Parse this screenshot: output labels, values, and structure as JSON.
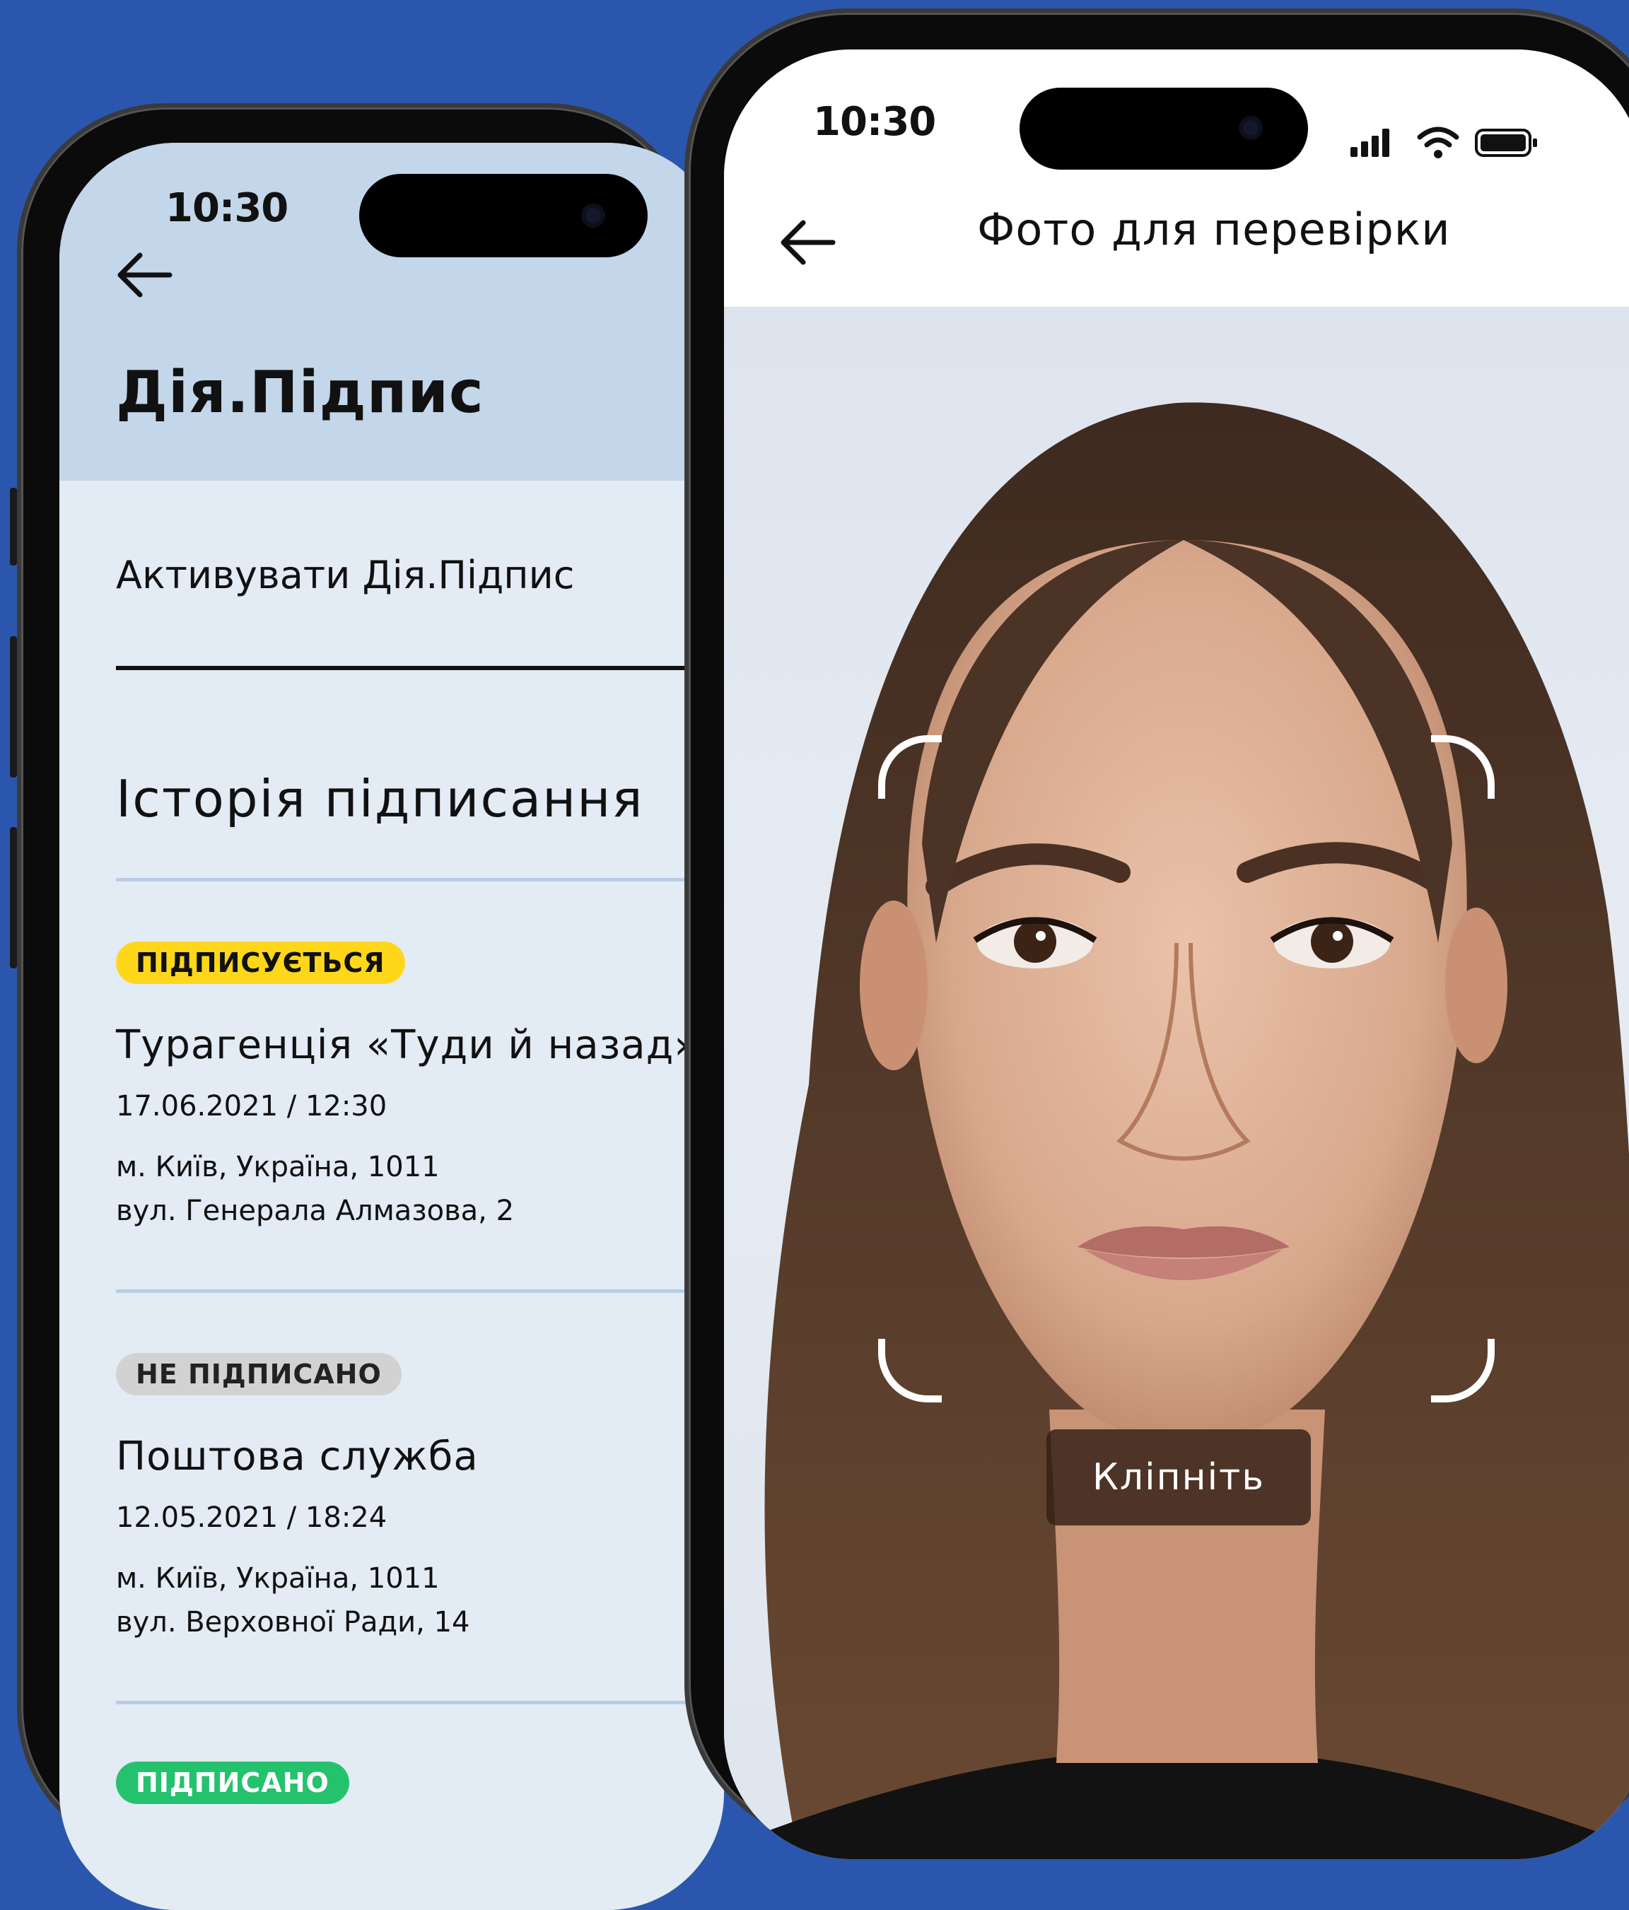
{
  "colors": {
    "background": "#2a57ad",
    "left_header": "#c3d6ea",
    "left_body": "#e3ebf5",
    "badge_signing": "#ffd71a",
    "badge_not_signed": "#d2d2d2",
    "badge_signed": "#25c26e"
  },
  "left_screen": {
    "status_time": "10:30",
    "title": "Дія.Підпис",
    "activate_label": "Активувати Дія.Підпис",
    "history_title": "Історія підписання",
    "entries": [
      {
        "badge": "ПІДПИСУЄТЬСЯ",
        "name": "Турагенція «Туди й назад»",
        "datetime": "17.06.2021 / 12:30",
        "address_line1": "м. Київ, Україна, 1011",
        "address_line2": "вул. Генерала Алмазова, 2"
      },
      {
        "badge": "НЕ ПІДПИСАНО",
        "name": "Поштова служба",
        "datetime": "12.05.2021 / 18:24",
        "address_line1": "м. Київ, Україна, 1011",
        "address_line2": "вул. Верховної Ради, 14"
      },
      {
        "badge": "ПІДПИСАНО"
      }
    ]
  },
  "right_screen": {
    "status_time": "10:30",
    "title": "Фото для перевірки",
    "instruction": "Кліпніть",
    "icons": [
      "back-arrow-icon",
      "signal-icon",
      "wifi-icon",
      "battery-icon"
    ]
  }
}
